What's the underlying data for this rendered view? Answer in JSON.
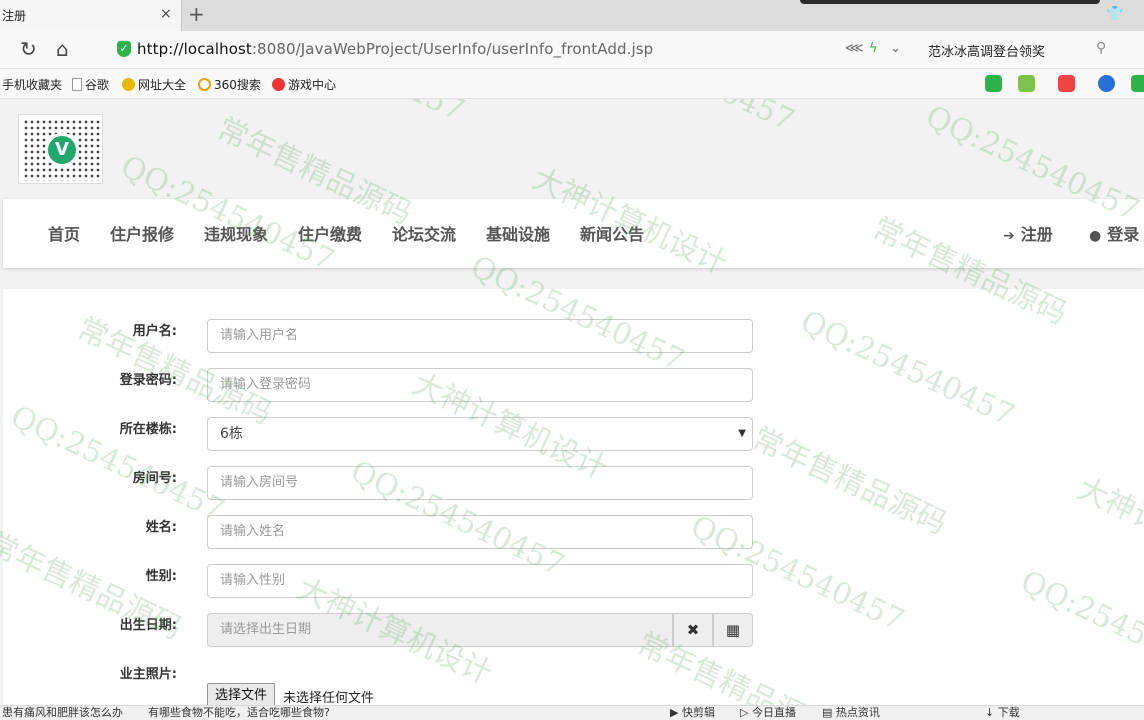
{
  "browser": {
    "tab_title": "注册",
    "tab_close": "×",
    "tab_new": "+",
    "url_host": "http://localhost",
    "url_rest": ":8080/JavaWebProject/UserInfo/userInfo_frontAdd.jsp",
    "search_hint": "范冰冰高调登台领奖",
    "bookmarks": [
      "手机收藏夹",
      "谷歌",
      "网址大全",
      "360搜索",
      "游戏中心"
    ]
  },
  "nav": {
    "items": [
      "首页",
      "住户报修",
      "违规现象",
      "住户缴费",
      "论坛交流",
      "基础设施",
      "新闻公告"
    ],
    "register": "注册",
    "login": "登录"
  },
  "form": {
    "username": {
      "label": "用户名:",
      "placeholder": "请输入用户名"
    },
    "password": {
      "label": "登录密码:",
      "placeholder": "请输入登录密码"
    },
    "building": {
      "label": "所在楼栋:",
      "value": "6栋"
    },
    "room": {
      "label": "房间号:",
      "placeholder": "请输入房间号"
    },
    "name": {
      "label": "姓名:",
      "placeholder": "请输入姓名"
    },
    "gender": {
      "label": "性别:",
      "placeholder": "请输入性别"
    },
    "birth": {
      "label": "出生日期:",
      "placeholder": "请选择出生日期"
    },
    "photo": {
      "label": "业主照片:",
      "button": "选择文件",
      "status": "未选择任何文件"
    }
  },
  "status": {
    "news1": "患有痛风和肥胖该怎么办",
    "news2": "有哪些食物不能吃，适合吃哪些食物?",
    "tools": [
      "快剪辑",
      "今日直播",
      "热点资讯",
      "下载"
    ]
  },
  "watermark": {
    "qq": "QQ:254540457",
    "brand1": "常年售精品源码",
    "brand2": "大神计算机设计"
  },
  "colors": {
    "accent": "#2db34a",
    "nav_text": "#555555"
  }
}
